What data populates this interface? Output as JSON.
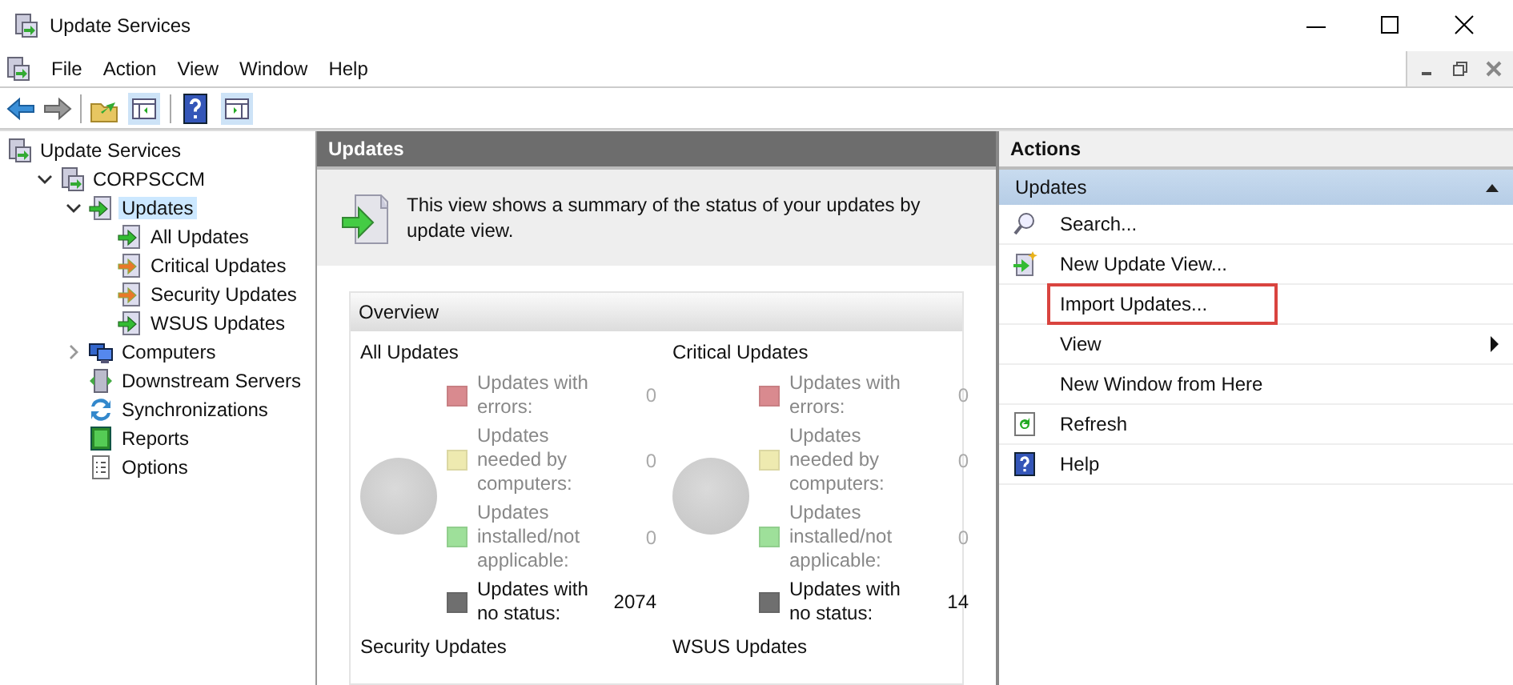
{
  "window": {
    "title": "Update Services"
  },
  "menu": [
    "File",
    "Action",
    "View",
    "Window",
    "Help"
  ],
  "tree": [
    {
      "label": "Update Services",
      "kind": "server",
      "selected": false,
      "children": [
        {
          "label": "CORPSCCM",
          "kind": "server",
          "expanded": true,
          "selected": false,
          "children": [
            {
              "label": "Updates",
              "kind": "updates",
              "expanded": true,
              "selected": true,
              "children": [
                {
                  "label": "All Updates",
                  "kind": "updates",
                  "selected": false
                },
                {
                  "label": "Critical Updates",
                  "kind": "critical",
                  "selected": false
                },
                {
                  "label": "Security Updates",
                  "kind": "critical",
                  "selected": false
                },
                {
                  "label": "WSUS Updates",
                  "kind": "updates",
                  "selected": false
                }
              ]
            },
            {
              "label": "Computers",
              "kind": "computers",
              "expanded": false,
              "selected": false
            },
            {
              "label": "Downstream Servers",
              "kind": "downstream",
              "selected": false
            },
            {
              "label": "Synchronizations",
              "kind": "sync",
              "selected": false
            },
            {
              "label": "Reports",
              "kind": "reports",
              "selected": false
            },
            {
              "label": "Options",
              "kind": "options",
              "selected": false
            }
          ]
        }
      ]
    }
  ],
  "center": {
    "title": "Updates",
    "description": "This view shows a summary of the status of your updates by update view.",
    "overview": {
      "title": "Overview",
      "sections": [
        {
          "title": "All Updates",
          "rows": [
            {
              "label": "Updates with errors:",
              "value": "0",
              "color": "#d98a8f",
              "dimmed": true
            },
            {
              "label": "Updates needed by computers:",
              "value": "0",
              "color": "#eeeab0",
              "dimmed": true
            },
            {
              "label": "Updates installed/not applicable:",
              "value": "0",
              "color": "#9ee09a",
              "dimmed": true
            },
            {
              "label": "Updates with no status:",
              "value": "2074",
              "color": "#6f6f6f",
              "dimmed": false
            }
          ]
        },
        {
          "title": "Critical Updates",
          "rows": [
            {
              "label": "Updates with errors:",
              "value": "0",
              "color": "#d98a8f",
              "dimmed": true
            },
            {
              "label": "Updates needed by computers:",
              "value": "0",
              "color": "#eeeab0",
              "dimmed": true
            },
            {
              "label": "Updates installed/not applicable:",
              "value": "0",
              "color": "#9ee09a",
              "dimmed": true
            },
            {
              "label": "Updates with no status:",
              "value": "14",
              "color": "#6f6f6f",
              "dimmed": false
            }
          ]
        },
        {
          "title": "Security Updates"
        },
        {
          "title": "WSUS Updates"
        }
      ]
    }
  },
  "actions": {
    "title": "Actions",
    "group": "Updates",
    "items": [
      {
        "label": "Search...",
        "kind": "search",
        "highlighted": false,
        "submenu": false
      },
      {
        "label": "New Update View...",
        "kind": "newview",
        "highlighted": false,
        "submenu": false
      },
      {
        "label": "Import Updates...",
        "kind": "plain",
        "highlighted": true,
        "submenu": false
      },
      {
        "label": "View",
        "kind": "plain",
        "highlighted": false,
        "submenu": true
      },
      {
        "label": "New Window from Here",
        "kind": "plain",
        "highlighted": false,
        "submenu": false
      },
      {
        "label": "Refresh",
        "kind": "refresh",
        "highlighted": false,
        "submenu": false
      },
      {
        "label": "Help",
        "kind": "help",
        "highlighted": false,
        "submenu": false
      }
    ]
  }
}
